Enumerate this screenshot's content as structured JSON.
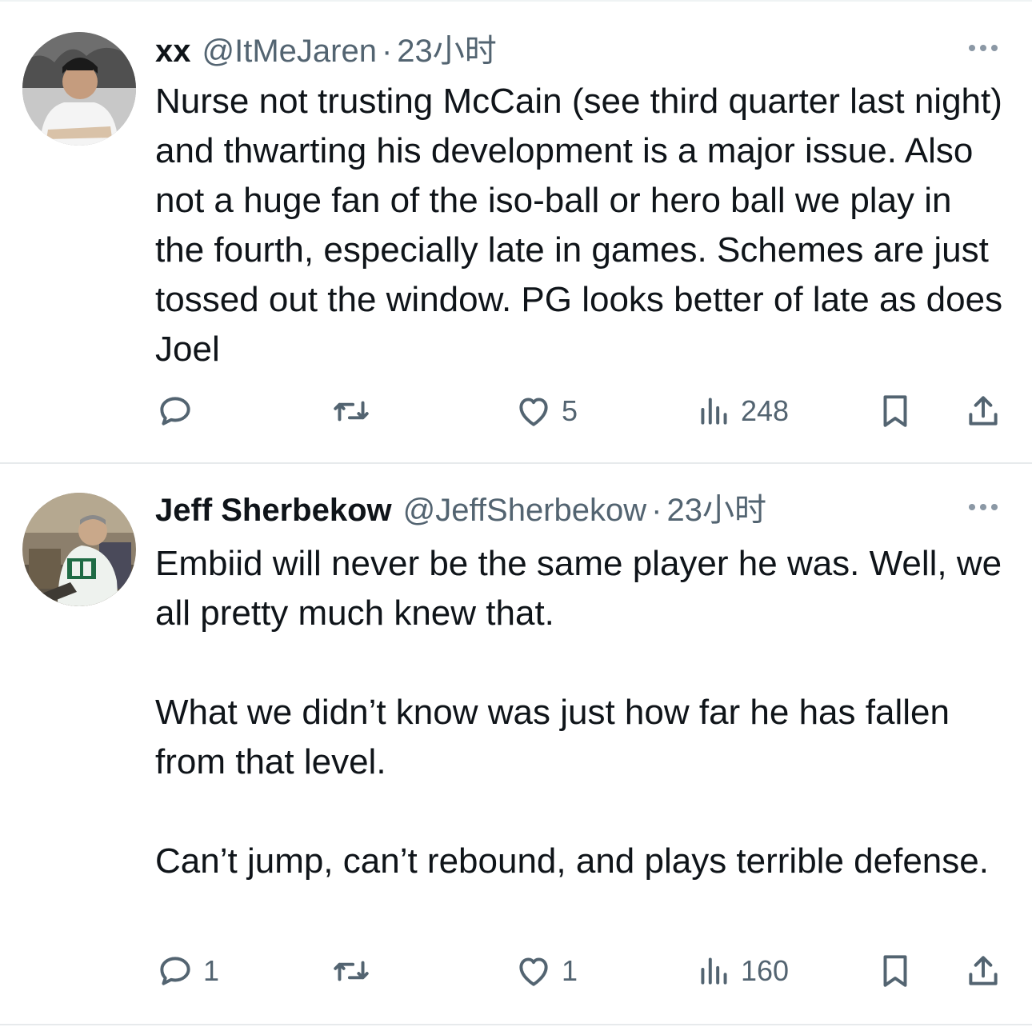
{
  "tweets": [
    {
      "display_name": "xx",
      "handle": "@ItMeJaren",
      "separator": "·",
      "time": "23小时",
      "paragraphs": [
        "Nurse not trusting McCain (see third quarter last night) and thwarting his development is a major issue. Also not a huge fan of the iso-ball or hero ball we play in the fourth, especially late in games. Schemes are just tossed out the window. PG looks better of late as does Joel"
      ],
      "replies": "",
      "retweets": "",
      "likes": "5",
      "views": "248"
    },
    {
      "display_name": "Jeff Sherbekow",
      "handle": "@JeffSherbekow",
      "separator": "·",
      "time": "23小时",
      "paragraphs": [
        "Embiid will never be the same player he was. Well, we all pretty much knew that.",
        "What we didn’t know was just how far he has fallen from that level.",
        "Can’t jump, can’t rebound, and plays terrible defense."
      ],
      "replies": "1",
      "retweets": "",
      "likes": "1",
      "views": "160"
    }
  ],
  "icons": {
    "more": "more-horizontal-icon",
    "reply": "reply-bubble-icon",
    "retweet": "retweet-icon",
    "like": "heart-icon",
    "views": "analytics-bars-icon",
    "bookmark": "bookmark-icon",
    "share": "share-upload-icon"
  },
  "colors": {
    "text": "#0f1419",
    "secondary": "#536471",
    "divider": "#e7eaec"
  }
}
